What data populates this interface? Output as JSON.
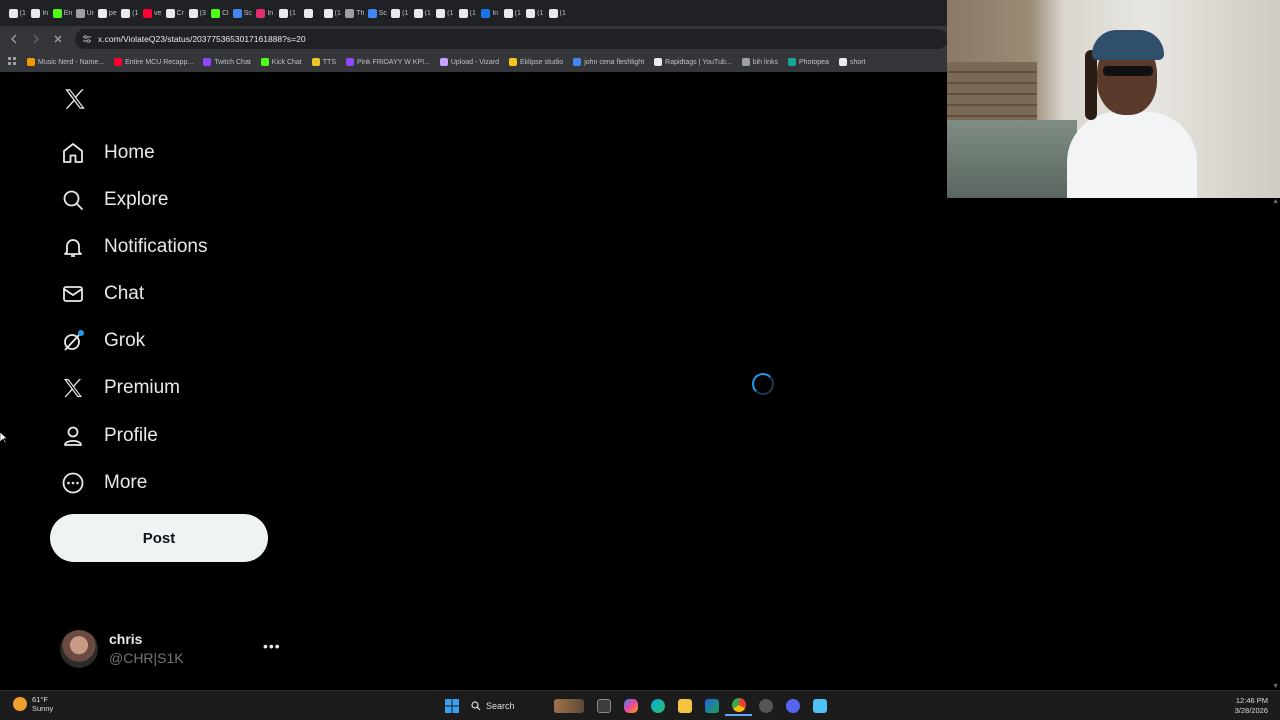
{
  "browser": {
    "tabs": [
      {
        "icon": "x-icon",
        "label": "(1",
        "color": "#e7e9ea"
      },
      {
        "icon": "shield-icon",
        "label": "In",
        "color": "#e7e9ea"
      },
      {
        "icon": "kick-icon",
        "label": "En",
        "color": "#53fc18"
      },
      {
        "icon": "globe-icon",
        "label": "Ur",
        "color": "#9aa0a6"
      },
      {
        "icon": "google-icon",
        "label": "pe",
        "color": "#e8eaed"
      },
      {
        "icon": "x-icon",
        "label": "(1",
        "color": "#e7e9ea"
      },
      {
        "icon": "youtube-icon",
        "label": "ve",
        "color": "#ff0033"
      },
      {
        "icon": "tiktok-icon",
        "label": "Cr",
        "color": "#e7e9ea"
      },
      {
        "icon": "tiktok-icon",
        "label": "(3",
        "color": "#e7e9ea"
      },
      {
        "icon": "kick-icon",
        "label": "Cl",
        "color": "#53fc18"
      },
      {
        "icon": "app-icon",
        "label": "Sc",
        "color": "#4285f4"
      },
      {
        "icon": "instagram-icon",
        "label": "In",
        "color": "#e1306c"
      },
      {
        "icon": "x-icon",
        "label": "(1",
        "color": "#e7e9ea"
      },
      {
        "icon": "x-icon",
        "label": "",
        "color": "#e7e9ea"
      },
      {
        "icon": "x-icon",
        "label": "(1",
        "color": "#e7e9ea"
      },
      {
        "icon": "dash-icon",
        "label": "Th",
        "color": "#9aa0a6"
      },
      {
        "icon": "app-icon",
        "label": "Sc",
        "color": "#4285f4"
      },
      {
        "icon": "x-icon",
        "label": "(1",
        "color": "#e7e9ea"
      },
      {
        "icon": "x-icon",
        "label": "(1",
        "color": "#e7e9ea"
      },
      {
        "icon": "x-icon",
        "label": "(1",
        "color": "#e7e9ea"
      },
      {
        "icon": "x-icon",
        "label": "(1",
        "color": "#e7e9ea"
      },
      {
        "icon": "app-icon",
        "label": "In",
        "color": "#1a73e8"
      },
      {
        "icon": "x-icon",
        "label": "(1",
        "color": "#e7e9ea"
      },
      {
        "icon": "x-icon",
        "label": "(1",
        "color": "#e7e9ea"
      },
      {
        "icon": "x-icon",
        "label": "(1",
        "color": "#e7e9ea"
      }
    ],
    "url": "x.com/ViolateQ23/status/2037753653017161888?s=20",
    "bookmarks": [
      {
        "label": "Music Nerd - Name...",
        "color": "#f29900"
      },
      {
        "label": "Entire MCU Recapp...",
        "color": "#ff0033"
      },
      {
        "label": "Twitch Chat",
        "color": "#9146ff"
      },
      {
        "label": "Kick Chat",
        "color": "#53fc18"
      },
      {
        "label": "TTS",
        "color": "#e8c52a"
      },
      {
        "label": "Pink FRIDAYY W KPI...",
        "color": "#9146ff"
      },
      {
        "label": "Upload - Vizard",
        "color": "#c8a2ff"
      },
      {
        "label": "Eklipse studio",
        "color": "#f5c518"
      },
      {
        "label": "john cena fleshlight",
        "color": "#4285f4"
      },
      {
        "label": "Rapidtags | YouTub...",
        "color": "#e8eaed"
      },
      {
        "label": "bih links",
        "color": "#9aa0a6"
      },
      {
        "label": "Photopea",
        "color": "#18a497"
      },
      {
        "label": "short",
        "color": "#e8eaed"
      }
    ]
  },
  "sidebar": {
    "items": [
      {
        "label": "Home",
        "icon": "home-icon",
        "name": "home"
      },
      {
        "label": "Explore",
        "icon": "search-icon",
        "name": "explore"
      },
      {
        "label": "Notifications",
        "icon": "bell-icon",
        "name": "notifications"
      },
      {
        "label": "Chat",
        "icon": "mail-icon",
        "name": "chat"
      },
      {
        "label": "Grok",
        "icon": "grok-icon",
        "name": "grok"
      },
      {
        "label": "Premium",
        "icon": "x-icon",
        "name": "premium"
      },
      {
        "label": "Profile",
        "icon": "person-icon",
        "name": "profile"
      },
      {
        "label": "More",
        "icon": "more-circle-icon",
        "name": "more"
      }
    ],
    "post_label": "Post"
  },
  "account": {
    "name": "chris",
    "handle": "@CHR|S1K",
    "more_label": "•••"
  },
  "taskbar": {
    "weather_temp": "61°F",
    "weather_desc": "Sunny",
    "search_label": "Search",
    "time": "12:46 PM",
    "date": "3/28/2026"
  },
  "colors": {
    "accent": "#1d9bf0",
    "background": "#000000",
    "post_button": "#eff3f4"
  }
}
